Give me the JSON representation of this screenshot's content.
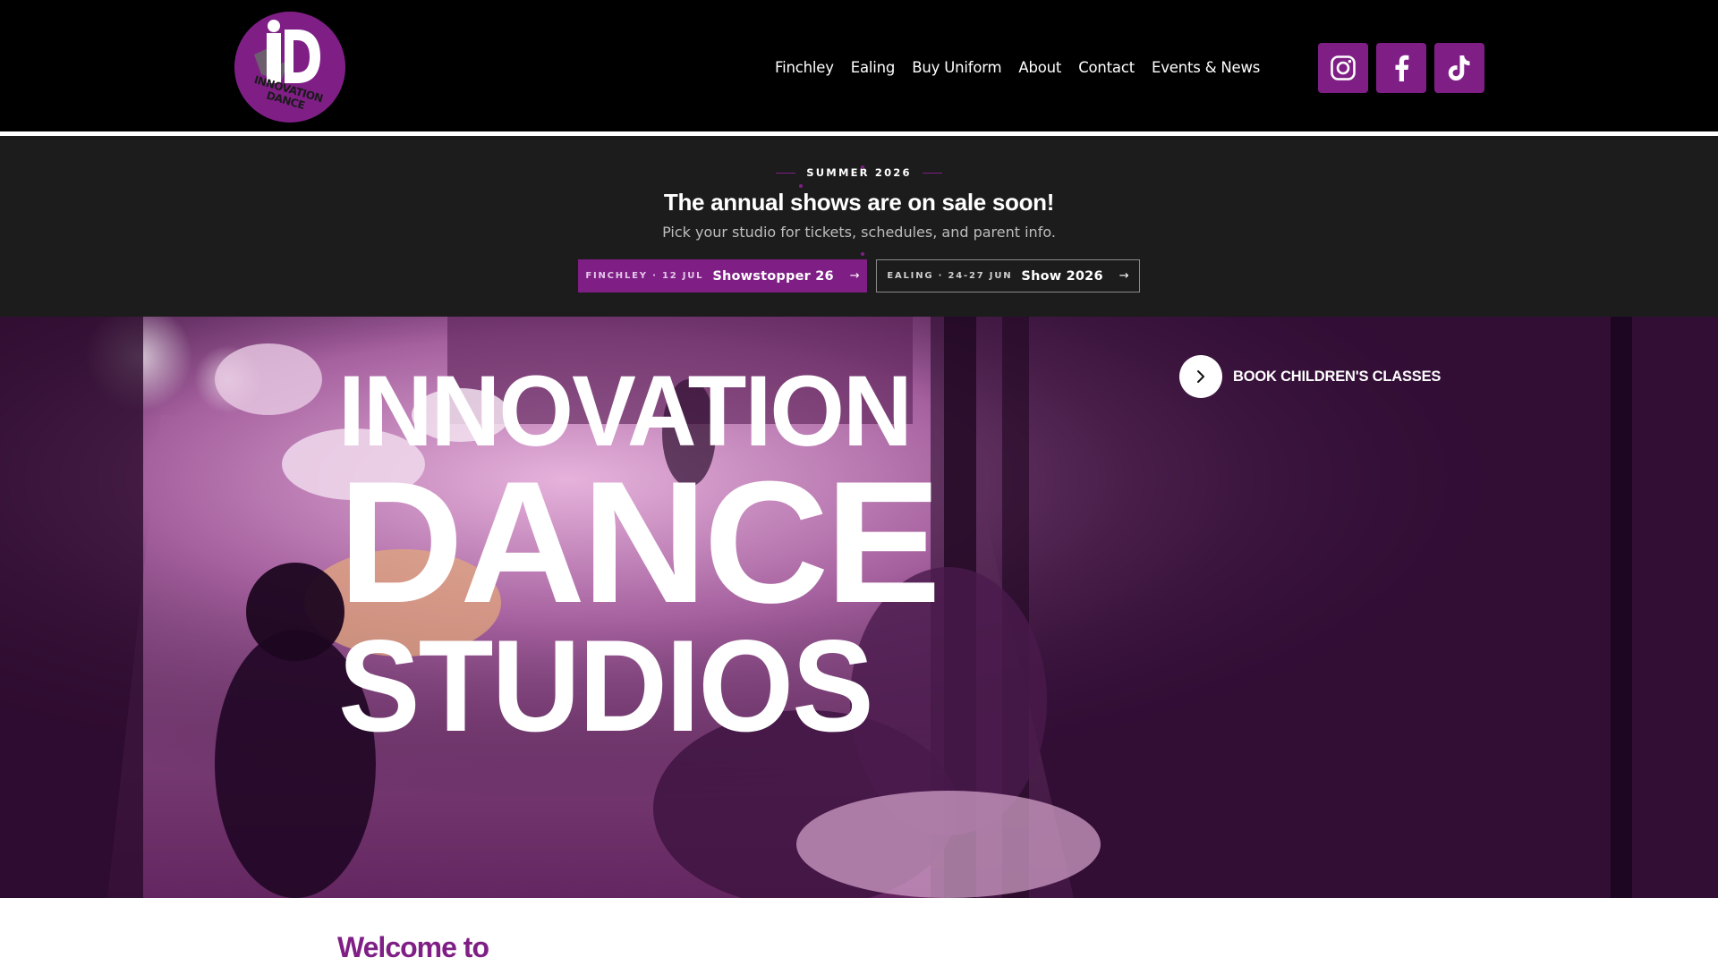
{
  "header": {
    "logo": {
      "initials": "iD",
      "line1": "INNOVATION",
      "line2": "DANCE"
    },
    "nav": [
      "Finchley",
      "Ealing",
      "Buy Uniform",
      "About",
      "Contact",
      "Events & News"
    ],
    "socials": [
      "instagram-icon",
      "facebook-icon",
      "tiktok-icon"
    ]
  },
  "banner": {
    "eyebrow": "SUMMER 2026",
    "title": "The annual shows are on sale soon!",
    "subtitle": "Pick your studio for tickets, schedules, and parent info.",
    "buttons": [
      {
        "date": "FINCHLEY · 12 JUL",
        "name": "Showstopper 26",
        "arrow": "→"
      },
      {
        "date": "EALING · 24-27 JUN",
        "name": "Show 2026",
        "arrow": "→"
      }
    ]
  },
  "hero": {
    "line1": "INNOVATION",
    "line2": "DANCE",
    "line3": "STUDIOS",
    "cta": "BOOK CHILDREN'S CLASSES"
  },
  "welcome": {
    "heading": "Welcome to"
  },
  "colors": {
    "brand_purple": "#7f1f86",
    "header_bg": "#000000",
    "banner_bg": "#1c1c1c",
    "hero_overlay": "#3d1240"
  }
}
